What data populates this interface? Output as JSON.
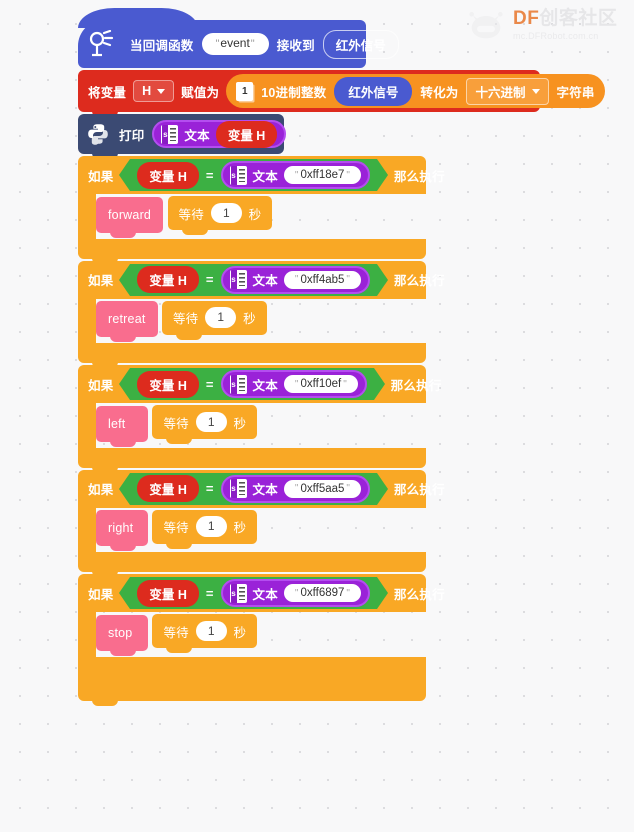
{
  "watermark": {
    "logo_icon": "df-robot-head-icon",
    "title_primary": "DF",
    "title_secondary": "创客社区",
    "subtitle": "mc.DFRobot.com.cn"
  },
  "canvas": {
    "background_color": "#f8f8f9",
    "grid_dot_color": "#dcdcdf"
  },
  "script": {
    "hat": {
      "icon": "infrared-receiver-icon",
      "label_pre": "当回调函数",
      "event_value": "event",
      "quote": "\"",
      "label_mid": "接收到",
      "signal_label": "红外信号",
      "color": "#4a5ad0"
    },
    "set_variable": {
      "label_pre": "将变量",
      "variable": "H",
      "label_assign": "赋值为",
      "color": "#dd2b1e",
      "converter": {
        "page_icon_text": "1",
        "label_base": "10进制整数",
        "source": "红外信号",
        "label_to": "转化为",
        "target_format": "十六进制",
        "label_string": "字符串",
        "color": "#f79220"
      }
    },
    "print": {
      "icon": "python-icon",
      "label": "打印",
      "text_icon": "text-string-icon",
      "text_label": "文本",
      "variable_label": "变量 H",
      "color": "#3b4a73"
    },
    "conditions": [
      {
        "if_label": "如果",
        "variable_label": "变量 H",
        "operator": "=",
        "text_icon": "text-string-icon",
        "text_label": "文本",
        "quote": "\"",
        "hex_value": "0xff18e7",
        "then_label": "那么执行",
        "command": "forward",
        "wait_label": "等待",
        "wait_value": "1",
        "wait_unit": "秒"
      },
      {
        "if_label": "如果",
        "variable_label": "变量 H",
        "operator": "=",
        "text_icon": "text-string-icon",
        "text_label": "文本",
        "quote": "\"",
        "hex_value": "0xff4ab5",
        "then_label": "那么执行",
        "command": "retreat",
        "wait_label": "等待",
        "wait_value": "1",
        "wait_unit": "秒"
      },
      {
        "if_label": "如果",
        "variable_label": "变量 H",
        "operator": "=",
        "text_icon": "text-string-icon",
        "text_label": "文本",
        "quote": "\"",
        "hex_value": "0xff10ef",
        "then_label": "那么执行",
        "command": "left",
        "wait_label": "等待",
        "wait_value": "1",
        "wait_unit": "秒"
      },
      {
        "if_label": "如果",
        "variable_label": "变量 H",
        "operator": "=",
        "text_icon": "text-string-icon",
        "text_label": "文本",
        "quote": "\"",
        "hex_value": "0xff5aa5",
        "then_label": "那么执行",
        "command": "right",
        "wait_label": "等待",
        "wait_value": "1",
        "wait_unit": "秒"
      },
      {
        "if_label": "如果",
        "variable_label": "变量 H",
        "operator": "=",
        "text_icon": "text-string-icon",
        "text_label": "文本",
        "quote": "\"",
        "hex_value": "0xff6897",
        "then_label": "那么执行",
        "command": "stop",
        "wait_label": "等待",
        "wait_value": "1",
        "wait_unit": "秒"
      }
    ],
    "colors": {
      "if_block": "#f9a825",
      "condition": "#3cb043",
      "variable": "#dd2b1e",
      "text_reporter": "#9a22d8",
      "command": "#f96d8e"
    }
  }
}
